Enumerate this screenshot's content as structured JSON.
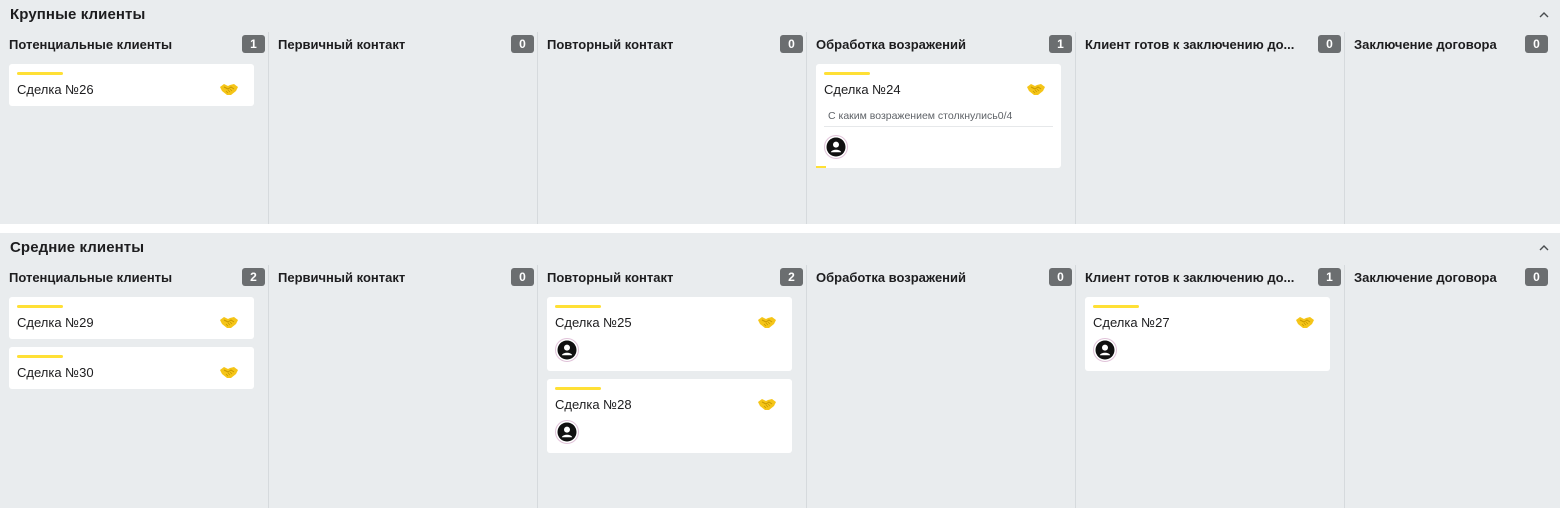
{
  "colors": {
    "background": "#e9ecee",
    "card": "#ffffff",
    "accent_stripe": "#ffe035",
    "count_badge": "#6b6e70",
    "deal_icon": "#f5c518"
  },
  "icons": {
    "collapse": "chevron-up-icon",
    "deal": "handshake-icon",
    "avatar": "user-circle-icon"
  },
  "groups": [
    {
      "title": "Крупные клиенты",
      "columns": [
        {
          "title": "Потенциальные клиенты",
          "count": "1",
          "cards": [
            {
              "title": "Сделка №26"
            }
          ]
        },
        {
          "title": "Первичный контакт",
          "count": "0",
          "cards": []
        },
        {
          "title": "Повторный контакт",
          "count": "0",
          "cards": []
        },
        {
          "title": "Обработка возражений",
          "count": "1",
          "cards": [
            {
              "title": "Сделка №24",
              "field": "С каким возражением столкнулись0/4",
              "avatar": true,
              "progress": 0.04
            }
          ]
        },
        {
          "title": "Клиент готов к заключению до...",
          "count": "0",
          "cards": []
        },
        {
          "title": "Заключение договора",
          "count": "0",
          "cards": []
        }
      ]
    },
    {
      "title": "Средние клиенты",
      "columns": [
        {
          "title": "Потенциальные клиенты",
          "count": "2",
          "cards": [
            {
              "title": "Сделка №29"
            },
            {
              "title": "Сделка №30"
            }
          ]
        },
        {
          "title": "Первичный контакт",
          "count": "0",
          "cards": []
        },
        {
          "title": "Повторный контакт",
          "count": "2",
          "cards": [
            {
              "title": "Сделка №25",
              "avatar": true
            },
            {
              "title": "Сделка №28",
              "avatar": true
            }
          ]
        },
        {
          "title": "Обработка возражений",
          "count": "0",
          "cards": []
        },
        {
          "title": "Клиент готов к заключению до...",
          "count": "1",
          "cards": [
            {
              "title": "Сделка №27",
              "avatar": true
            }
          ]
        },
        {
          "title": "Заключение договора",
          "count": "0",
          "cards": []
        }
      ]
    }
  ]
}
